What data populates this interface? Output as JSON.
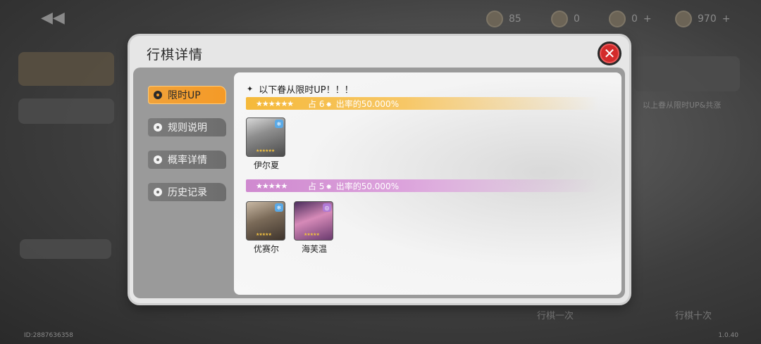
{
  "background": {
    "resources": [
      {
        "icon": "gear-coin-icon",
        "value": "85"
      },
      {
        "icon": "token-icon",
        "value": "0"
      },
      {
        "icon": "ticket-icon",
        "value": "0"
      },
      {
        "icon": "crystal-icon",
        "value": "970"
      }
    ],
    "side_note": "以上眷从限时UP&共涨",
    "left_button": "行棋一次",
    "right_button": "行棋十次",
    "footer_id": "ID:2887636358",
    "version": "1.0.40"
  },
  "dialog": {
    "title": "行棋详情",
    "close_label": "✕",
    "tabs": [
      {
        "label": "限时UP",
        "active": true
      },
      {
        "label": "规则说明",
        "active": false
      },
      {
        "label": "概率详情",
        "active": false
      },
      {
        "label": "历史记录",
        "active": false
      }
    ],
    "panel": {
      "heading": "以下眷从限时UP！！！",
      "groups": [
        {
          "stars": "★★★★★★",
          "prefix": "占",
          "rarity": "6",
          "suffix": "出率的50.000%",
          "color": "#f5b93a",
          "characters": [
            {
              "name": "伊尔夏",
              "badge": "❄",
              "badge_color": "#5aa9e6"
            }
          ]
        },
        {
          "stars": "★★★★★",
          "prefix": "占",
          "rarity": "5",
          "suffix": "出率的50.000%",
          "color": "#cf89cf",
          "characters": [
            {
              "name": "优赛尔",
              "badge": "❄",
              "badge_color": "#5aa9e6"
            },
            {
              "name": "海芙温",
              "badge": "◎",
              "badge_color": "#b07ad6"
            }
          ]
        }
      ]
    }
  }
}
